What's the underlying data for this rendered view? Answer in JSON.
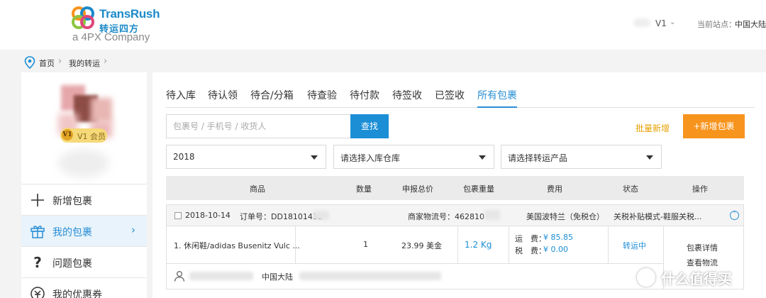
{
  "header": {
    "logo_en": "TransRush",
    "logo_cn": "转运四方",
    "logo_sub": "a 4PX Company",
    "user_level": "V1",
    "site_label": "当前站点：",
    "site_value": "中国大陆",
    "colors": {
      "brand": "#1b8ac9"
    }
  },
  "breadcrumb": {
    "home": "首页",
    "current": "我的转运"
  },
  "sidebar": {
    "vip_coin": "V1",
    "vip_label": "V1 会员",
    "items": [
      {
        "label": "新增包裹",
        "icon": "plus-icon",
        "active": false
      },
      {
        "label": "我的包裹",
        "icon": "gift-icon",
        "active": true
      },
      {
        "label": "问题包裹",
        "icon": "question-icon",
        "active": false
      },
      {
        "label": "我的优惠券",
        "icon": "coupon-icon",
        "active": false
      }
    ]
  },
  "tabs": [
    {
      "label": "待入库"
    },
    {
      "label": "待认领"
    },
    {
      "label": "待合/分箱"
    },
    {
      "label": "待查验"
    },
    {
      "label": "待付款"
    },
    {
      "label": "待签收"
    },
    {
      "label": "已签收"
    },
    {
      "label": "所有包裹",
      "active": true
    }
  ],
  "search": {
    "placeholder": "包裹号 / 手机号 / 收货人",
    "button": "查找"
  },
  "actions": {
    "batch_add": "批量新增",
    "add_package": "+新增包裹",
    "colors": {
      "batch": "#e6a100",
      "add": "#f7941d"
    }
  },
  "filters": {
    "year": "2018",
    "warehouse": "请选择入库仓库",
    "product": "请选择转运产品"
  },
  "table": {
    "columns": [
      "商品",
      "数量",
      "申报总价",
      "包裹重量",
      "费用",
      "状态",
      "操作"
    ]
  },
  "order": {
    "date": "2018-10-14",
    "order_no": "订单号：DD18101432",
    "tracking": "商家物流号：462810",
    "route": "美国波特兰（免税仓）",
    "mode": "关税补贴模式-鞋服关税...",
    "item": "1. 休闲鞋/adidas Busenitz Vulc ...",
    "qty": "1",
    "declared": "23.99 美金",
    "weight": "1.2 Kg",
    "freight_label": "运　费：",
    "freight_value": "¥ 85.85",
    "tax_label": "税　费：",
    "tax_value": "¥ 0.00",
    "status": "转运中",
    "op_detail": "包裹详情",
    "op_track": "查看物流",
    "receiver_region": "中国大陆"
  },
  "watermark": {
    "badge": "值",
    "text": "什么值得买"
  }
}
